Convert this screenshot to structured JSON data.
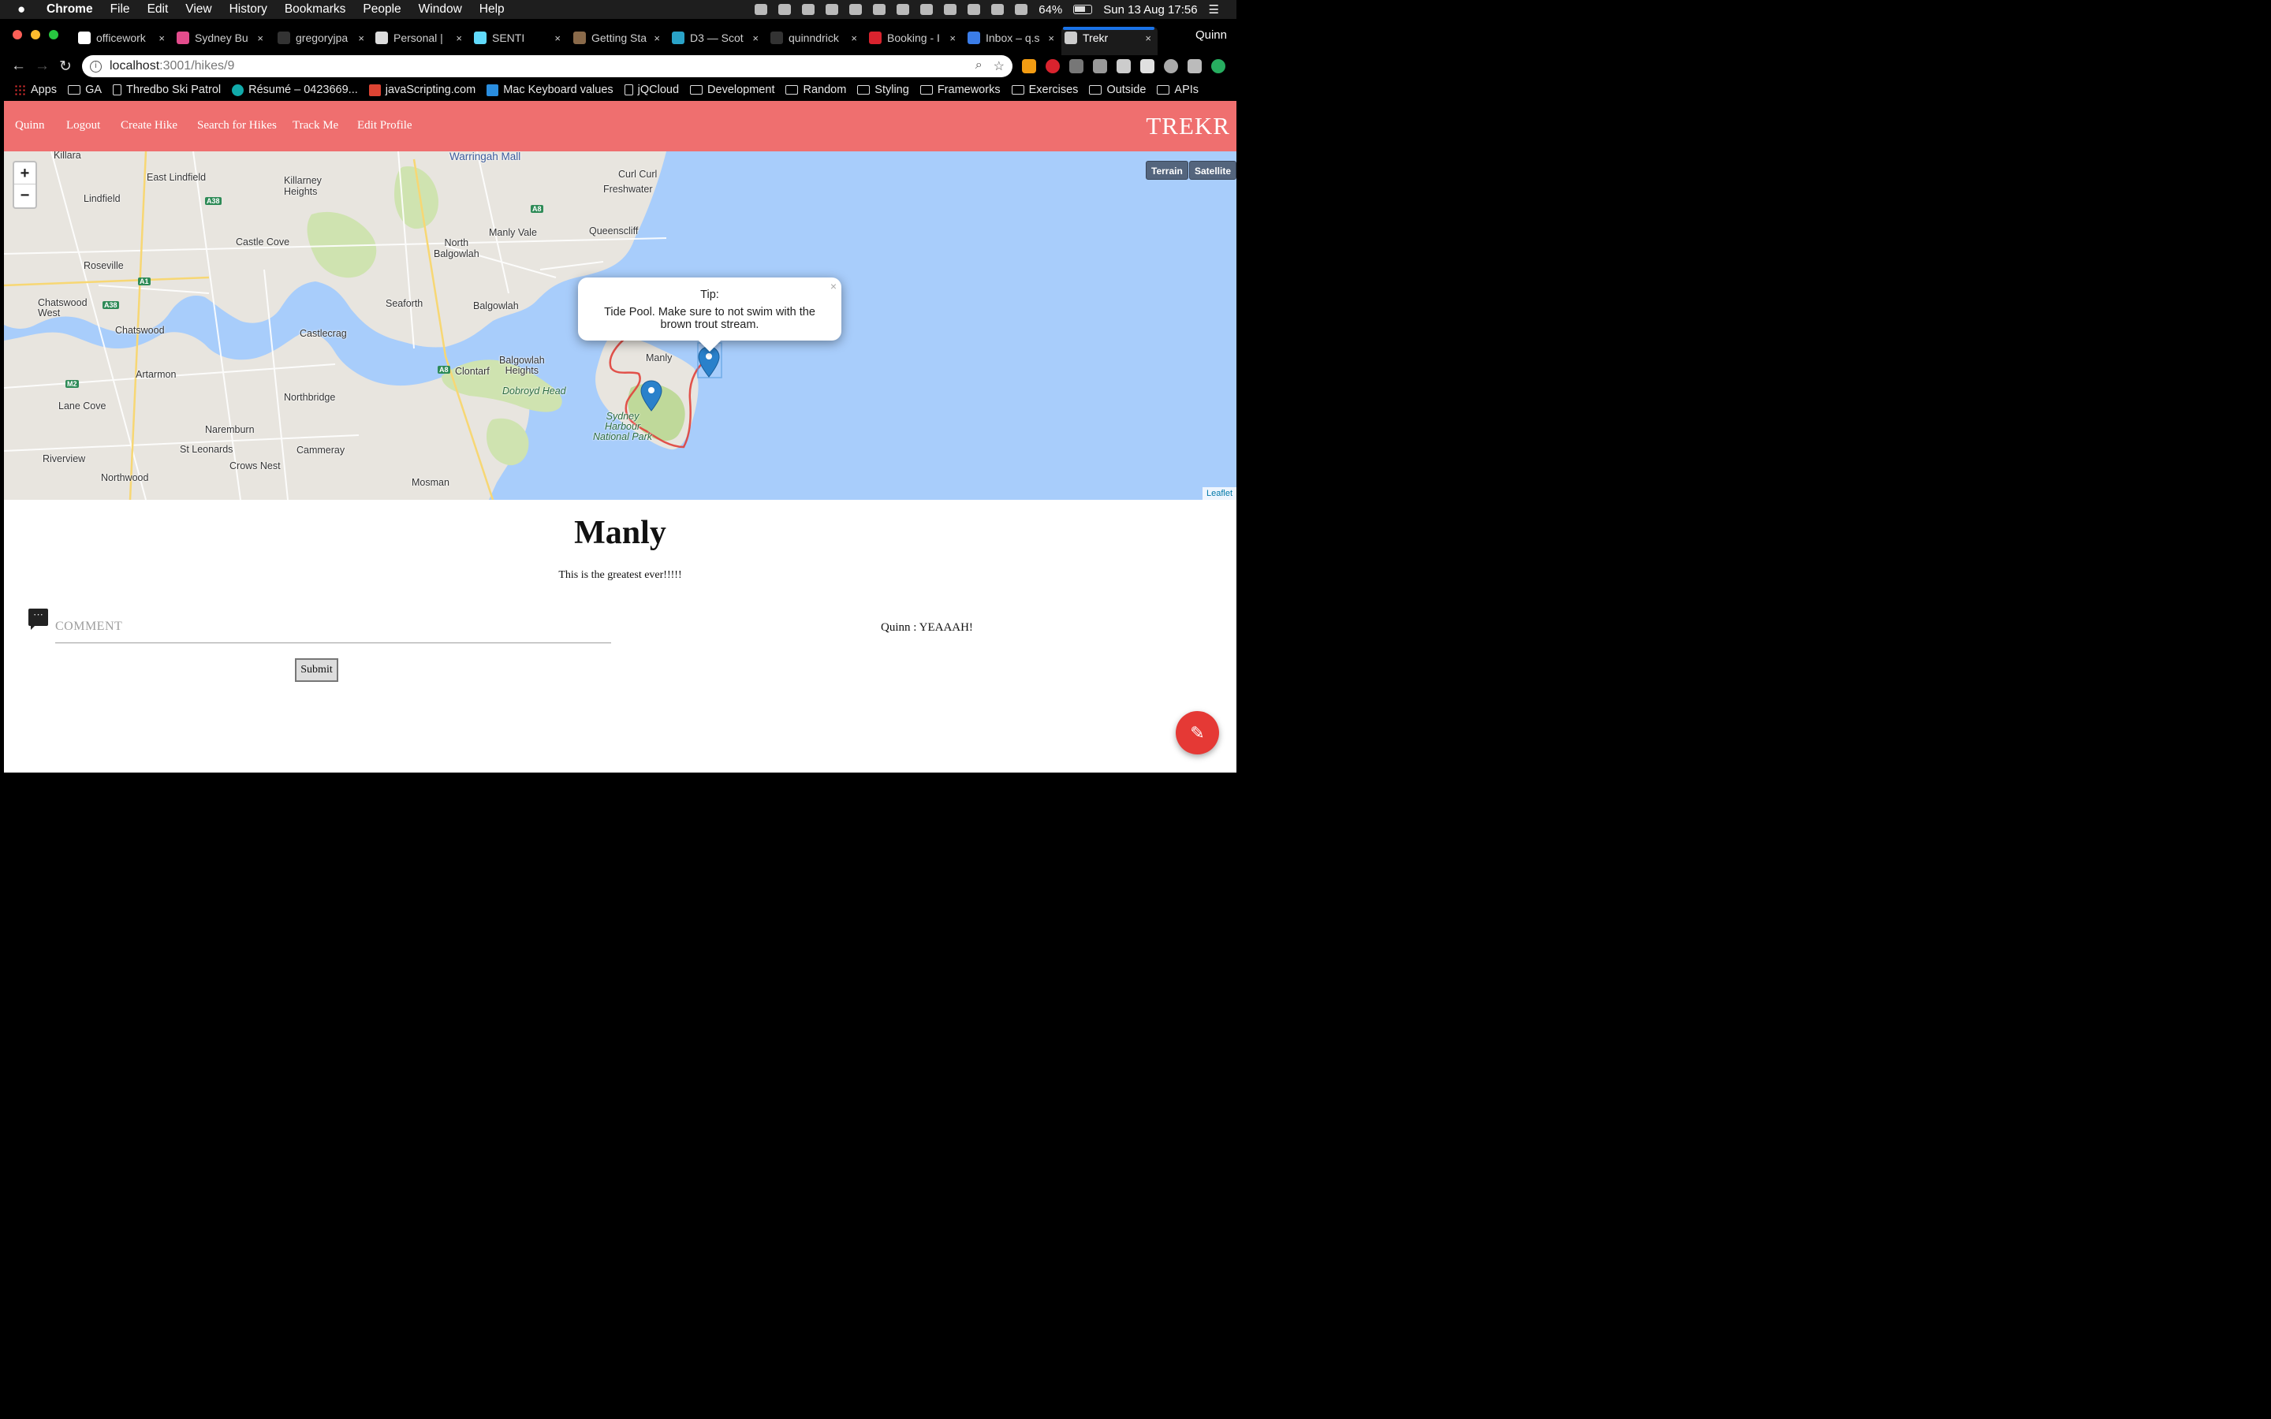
{
  "menubar": {
    "app_name": "Chrome",
    "items": [
      "File",
      "Edit",
      "View",
      "History",
      "Bookmarks",
      "People",
      "Window",
      "Help"
    ],
    "battery": "64%",
    "clock": "Sun 13 Aug  17:56"
  },
  "tabs": [
    {
      "title": "officework",
      "color": "#ffffff"
    },
    {
      "title": "Sydney Bu",
      "color": "#e34c8c"
    },
    {
      "title": "gregoryjpa",
      "color": "#333333"
    },
    {
      "title": "Personal |",
      "color": "#dddddd"
    },
    {
      "title": "SENTI",
      "color": "#61dafb"
    },
    {
      "title": "Getting Sta",
      "color": "#8a6a4a"
    },
    {
      "title": "D3 — Scot",
      "color": "#2aa3c8"
    },
    {
      "title": "quinndrick",
      "color": "#333333"
    },
    {
      "title": "Booking - I",
      "color": "#d9232e"
    },
    {
      "title": "Inbox – q.s",
      "color": "#3b7de8"
    },
    {
      "title": "Trekr",
      "color": "#cccccc"
    }
  ],
  "profile_name": "Quinn",
  "address": {
    "host": "localhost",
    "path": ":3001/hikes/9"
  },
  "bookmarks": [
    {
      "label": "Apps",
      "icon": "grid"
    },
    {
      "label": "GA",
      "icon": "folder"
    },
    {
      "label": "Thredbo Ski Patrol",
      "icon": "page"
    },
    {
      "label": "Résumé – 0423669...",
      "icon": "round"
    },
    {
      "label": "javaScripting.com",
      "icon": "js"
    },
    {
      "label": "Mac Keyboard values",
      "icon": "power"
    },
    {
      "label": "jQCloud",
      "icon": "page"
    },
    {
      "label": "Development",
      "icon": "folder"
    },
    {
      "label": "Random",
      "icon": "folder"
    },
    {
      "label": "Styling",
      "icon": "folder"
    },
    {
      "label": "Frameworks",
      "icon": "folder"
    },
    {
      "label": "Exercises",
      "icon": "folder"
    },
    {
      "label": "Outside",
      "icon": "folder"
    },
    {
      "label": "APIs",
      "icon": "folder"
    }
  ],
  "nav": {
    "links": [
      "Quinn",
      "Logout",
      "Create Hike",
      "Search for Hikes",
      "Track Me",
      "Edit Profile"
    ],
    "brand": "TREKR"
  },
  "map": {
    "zoom_in": "+",
    "zoom_out": "−",
    "layer_buttons": [
      "Terrain",
      "Satellite"
    ],
    "attribution": "Leaflet",
    "labels": {
      "warringah_mall": "Warringah Mall",
      "killara": "Killara",
      "east_lindfield": "East Lindfield",
      "lindfield": "Lindfield",
      "killarney_heights": "Killarney\nHeights",
      "curl_curl": "Curl Curl",
      "freshwater": "Freshwater",
      "queenscliff": "Queenscliff",
      "manly_vale": "Manly Vale",
      "north_balgowlah": "North\nBalgowlah",
      "castle_cove": "Castle Cove",
      "roseville": "Roseville",
      "chatswood_west": "Chatswood\nWest",
      "seaforth": "Seaforth",
      "balgowlah": "Balgowlah",
      "chatswood": "Chatswood",
      "castlecrag": "Castlecrag",
      "artarmon": "Artarmon",
      "clontarf": "Clontarf",
      "balgowlah_heights": "Balgowlah\nHeights",
      "dobroyd_head": "Dobroyd Head",
      "manly": "Manly",
      "northbridge": "Northbridge",
      "lane_cove": "Lane Cove",
      "naremburn": "Naremburn",
      "st_leonards": "St Leonards",
      "cammeray": "Cammeray",
      "crows_nest": "Crows Nest",
      "riverview": "Riverview",
      "northwood": "Northwood",
      "mosman": "Mosman",
      "sydney_harbour_np": "Sydney\nHarbour\nNational Park"
    },
    "popup": {
      "title": "Tip:",
      "body": "Tide Pool. Make sure to not swim with the brown trout stream.",
      "close": "×"
    }
  },
  "hike": {
    "title": "Manly",
    "description": "This is the greatest ever!!!!!"
  },
  "comment_form": {
    "placeholder": "COMMENT",
    "submit_label": "Submit"
  },
  "comments": [
    {
      "text": "Quinn : YEAAAH!"
    }
  ],
  "colors": {
    "nav_bg": "#ef6f6f",
    "water": "#a8cdfb",
    "fab": "#e53935",
    "route": "#e0403a",
    "marker": "#2a81cb"
  }
}
